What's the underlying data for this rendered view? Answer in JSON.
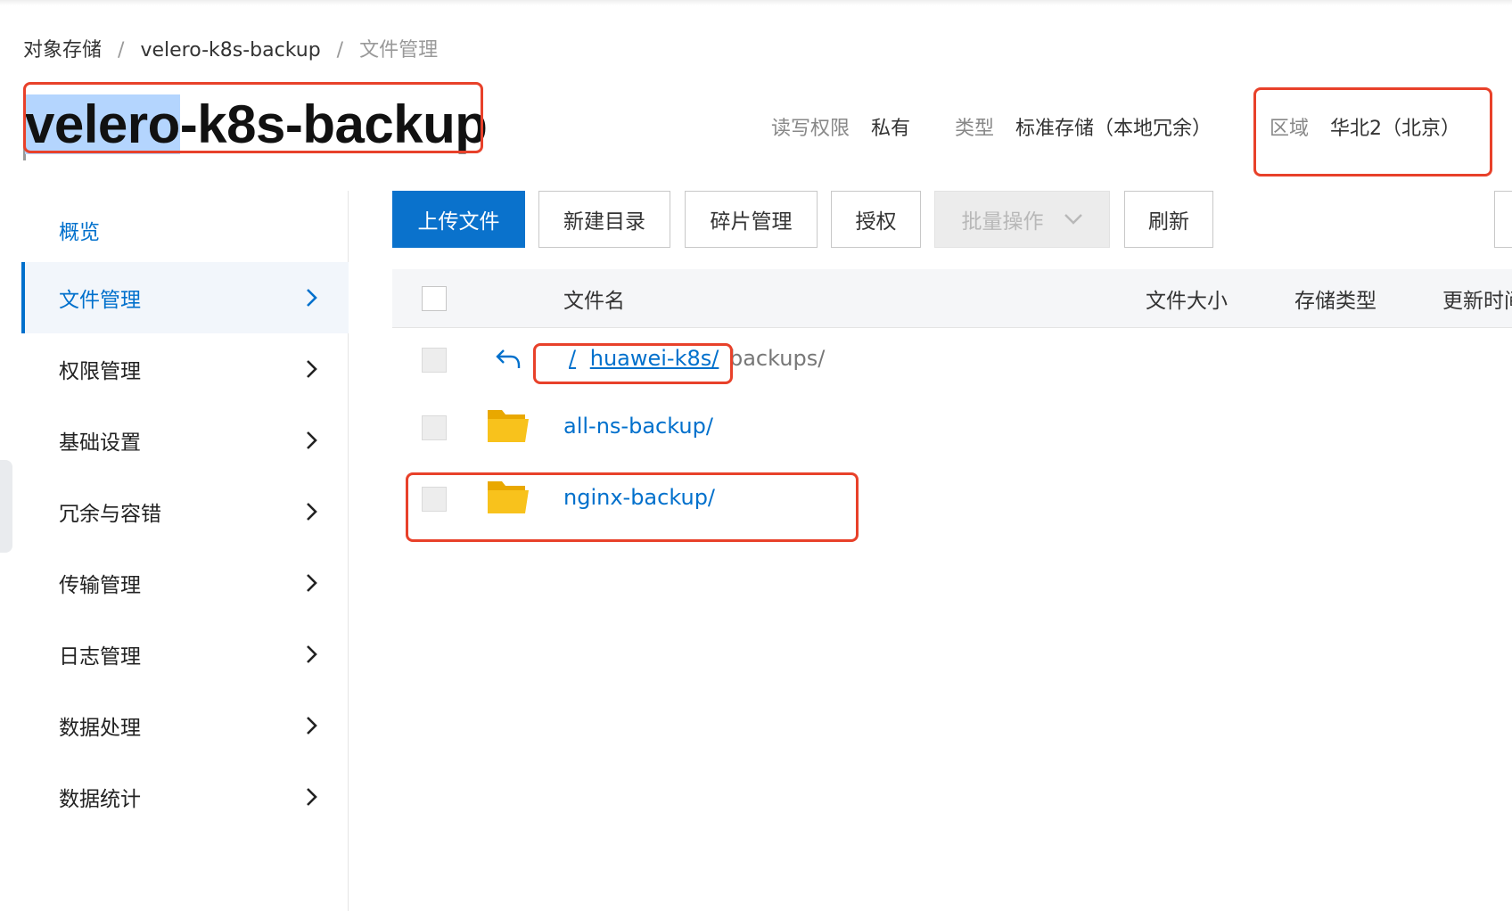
{
  "breadcrumb": {
    "root": "对象存储",
    "separator": "/",
    "bucket": "velero-k8s-backup",
    "current": "文件管理"
  },
  "bucket": {
    "name_selected_part": "velero",
    "name_rest": "-k8s-backup",
    "meta": {
      "permission_label": "读写权限",
      "permission_value": "私有",
      "type_label": "类型",
      "type_value": "标准存储（本地冗余）",
      "region_label": "区域",
      "region_value": "华北2（北京）"
    }
  },
  "sidebar": {
    "items": [
      {
        "label": "概览"
      },
      {
        "label": "文件管理"
      },
      {
        "label": "权限管理"
      },
      {
        "label": "基础设置"
      },
      {
        "label": "冗余与容错"
      },
      {
        "label": "传输管理"
      },
      {
        "label": "日志管理"
      },
      {
        "label": "数据处理"
      },
      {
        "label": "数据统计"
      }
    ]
  },
  "toolbar": {
    "upload": "上传文件",
    "new_dir": "新建目录",
    "fragments": "碎片管理",
    "authorize": "授权",
    "batch": "批量操作",
    "refresh": "刷新"
  },
  "table": {
    "columns": {
      "name": "文件名",
      "size": "文件大小",
      "storage_type": "存储类型",
      "updated": "更新时间"
    },
    "path": {
      "root": "/",
      "parent": "huawei-k8s/",
      "current": "backups/"
    },
    "rows": [
      {
        "name": "all-ns-backup/"
      },
      {
        "name": "nginx-backup/"
      }
    ]
  },
  "colors": {
    "primary": "#0a72cc",
    "link": "#0070cc",
    "highlight_box": "#e8412a",
    "folder": "#f8c21c"
  },
  "icons": {
    "folder": "folder-icon",
    "back": "back-arrow-icon",
    "chevron": "chevron-right-icon",
    "dropdown": "chevron-down-icon"
  }
}
